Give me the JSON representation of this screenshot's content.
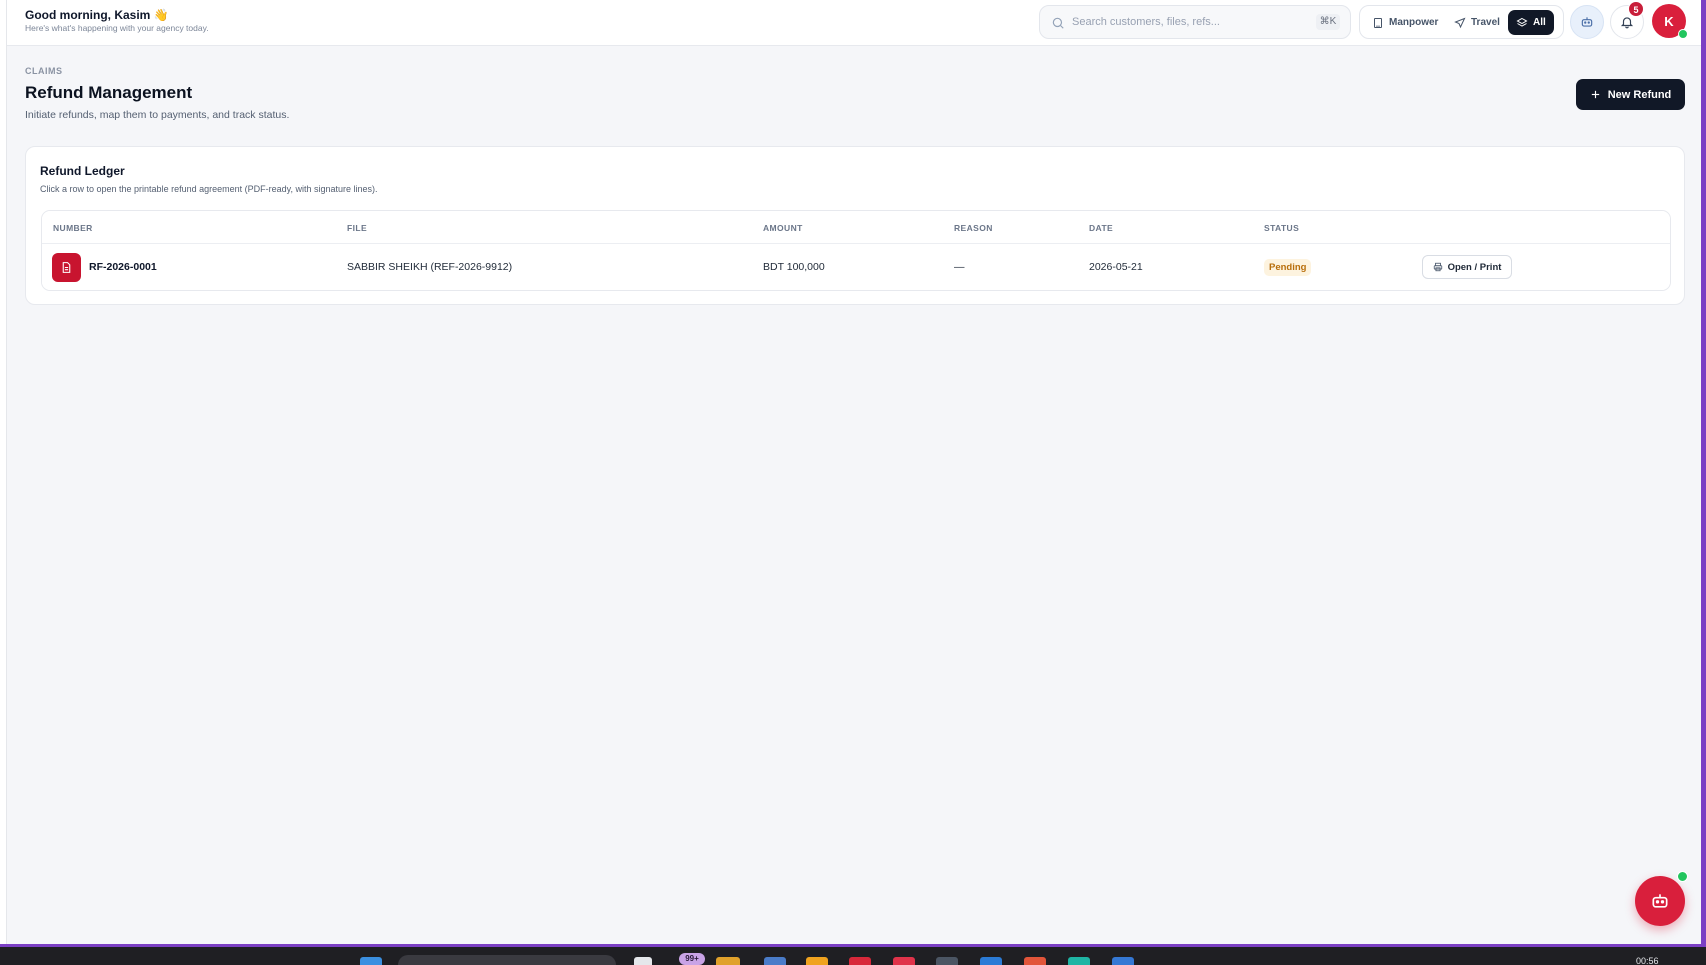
{
  "header": {
    "greeting": "Good morning, Kasim 👋",
    "subtitle": "Here's what's happening with your agency today.",
    "search_placeholder": "Search customers, files, refs...",
    "search_shortcut": "⌘K",
    "modes": [
      {
        "label": "Manpower",
        "icon": "building-icon"
      },
      {
        "label": "Travel",
        "icon": "plane-icon"
      },
      {
        "label": "All",
        "icon": "layers-icon",
        "active": true
      }
    ],
    "notification_count": "5",
    "avatar_initial": "K"
  },
  "page": {
    "eyebrow": "CLAIMS",
    "title": "Refund Management",
    "subtitle": "Initiate refunds, map them to payments, and track status.",
    "new_button": "New Refund"
  },
  "ledger": {
    "title": "Refund Ledger",
    "subtitle": "Click a row to open the printable refund agreement (PDF-ready, with signature lines).",
    "columns": [
      "NUMBER",
      "FILE",
      "AMOUNT",
      "REASON",
      "DATE",
      "STATUS"
    ],
    "rows": [
      {
        "number": "RF-2026-0001",
        "file": "SABBIR SHEIKH (REF-2026-9912)",
        "amount": "BDT 100,000",
        "reason": "—",
        "date": "2026-05-21",
        "status": "Pending",
        "action": "Open / Print"
      }
    ]
  },
  "taskbar": {
    "badge": "99+",
    "clock": "00:56"
  },
  "colors": {
    "primary_dark": "#111827",
    "accent_red": "#d91f3c",
    "pending_bg": "#fdf3df",
    "pending_text": "#b86e0b",
    "online_green": "#22c55e"
  }
}
